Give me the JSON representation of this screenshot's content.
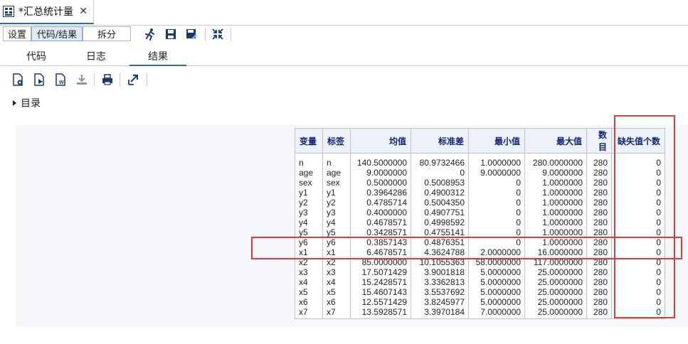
{
  "document_tab": {
    "title": "*汇总统计量",
    "close": "✕"
  },
  "toolbar": {
    "settings": "设置",
    "code_results": "代码/结果",
    "split": "拆分"
  },
  "subtabs": [
    "代码",
    "日志",
    "结果"
  ],
  "active_subtab": "结果",
  "toc": {
    "label": "目录"
  },
  "table": {
    "headers": [
      "变量",
      "标签",
      "均值",
      "标准差",
      "最小值",
      "最大值",
      "数目",
      "缺失值个数"
    ],
    "rows": [
      [
        "n",
        "n",
        "140.5000000",
        "80.9732466",
        "1.0000000",
        "280.0000000",
        "280",
        "0"
      ],
      [
        "age",
        "age",
        "9.0000000",
        "0",
        "9.0000000",
        "9.0000000",
        "280",
        "0"
      ],
      [
        "sex",
        "sex",
        "0.5000000",
        "0.5008953",
        "0",
        "1.0000000",
        "280",
        "0"
      ],
      [
        "y1",
        "y1",
        "0.3964286",
        "0.4900312",
        "0",
        "1.0000000",
        "280",
        "0"
      ],
      [
        "y2",
        "y2",
        "0.4785714",
        "0.5004350",
        "0",
        "1.0000000",
        "280",
        "0"
      ],
      [
        "y3",
        "y3",
        "0.4000000",
        "0.4907751",
        "0",
        "1.0000000",
        "280",
        "0"
      ],
      [
        "y4",
        "y4",
        "0.4678571",
        "0.4998592",
        "0",
        "1.0000000",
        "280",
        "0"
      ],
      [
        "y5",
        "y5",
        "0.3428571",
        "0.4755141",
        "0",
        "1.0000000",
        "280",
        "0"
      ],
      [
        "y6",
        "y6",
        "0.3857143",
        "0.4876351",
        "0",
        "1.0000000",
        "280",
        "0"
      ],
      [
        "x1",
        "x1",
        "6.4678571",
        "4.3624788",
        "2.0000000",
        "16.0000000",
        "280",
        "0"
      ],
      [
        "x2",
        "x2",
        "85.0000000",
        "10.1055363",
        "58.0000000",
        "117.0000000",
        "280",
        "0"
      ],
      [
        "x3",
        "x3",
        "17.5071429",
        "3.9001818",
        "5.0000000",
        "25.0000000",
        "280",
        "0"
      ],
      [
        "x4",
        "x4",
        "15.2428571",
        "3.3362813",
        "5.0000000",
        "25.0000000",
        "280",
        "0"
      ],
      [
        "x5",
        "x5",
        "15.4607143",
        "3.5537692",
        "5.0000000",
        "25.0000000",
        "280",
        "0"
      ],
      [
        "x6",
        "x6",
        "12.5571429",
        "3.8245977",
        "5.0000000",
        "25.0000000",
        "280",
        "0"
      ],
      [
        "x7",
        "x7",
        "13.5928571",
        "3.3970184",
        "7.0000000",
        "25.0000000",
        "280",
        "0"
      ]
    ]
  },
  "highlight": {
    "row_variable": "x2",
    "column": "缺失值个数",
    "color": "#e23a3a"
  },
  "icons": [
    "app-grid-icon",
    "run-icon",
    "save-icon",
    "save-as-icon",
    "maximize-icon",
    "export-html-icon",
    "export-pdf-icon",
    "export-word-icon",
    "download-icon",
    "print-icon",
    "open-new-window-icon"
  ]
}
